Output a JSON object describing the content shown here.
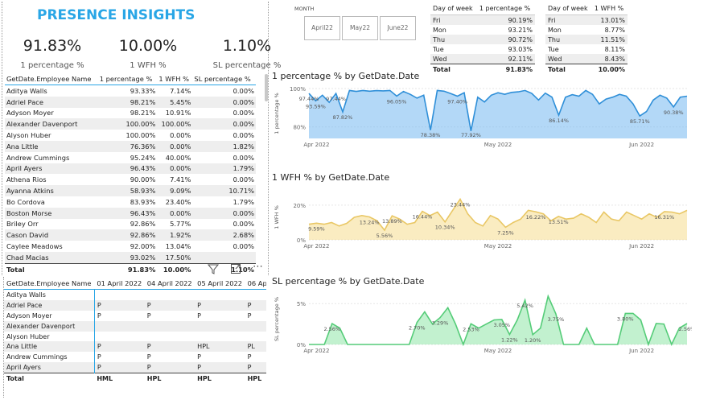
{
  "header": {
    "title": "PRESENCE INSIGHTS"
  },
  "kpis": [
    {
      "value": "91.83%",
      "label": "1 percentage %"
    },
    {
      "value": "10.00%",
      "label": "1 WFH %"
    },
    {
      "value": "1.10%",
      "label": "SL percentage %"
    }
  ],
  "employee_table": {
    "columns": [
      "GetDate.Employee Name",
      "1 percentage %",
      "1 WFH %",
      "SL percentage %"
    ],
    "rows": [
      [
        "Aditya Walls",
        "93.33%",
        "7.14%",
        "0.00%"
      ],
      [
        "Adriel Pace",
        "98.21%",
        "5.45%",
        "0.00%"
      ],
      [
        "Adyson Moyer",
        "98.21%",
        "10.91%",
        "0.00%"
      ],
      [
        "Alexander Davenport",
        "100.00%",
        "100.00%",
        "0.00%"
      ],
      [
        "Alyson Huber",
        "100.00%",
        "0.00%",
        "0.00%"
      ],
      [
        "Ana Little",
        "76.36%",
        "0.00%",
        "1.82%"
      ],
      [
        "Andrew Cummings",
        "95.24%",
        "40.00%",
        "0.00%"
      ],
      [
        "April Ayers",
        "96.43%",
        "0.00%",
        "1.79%"
      ],
      [
        "Athena Rios",
        "90.00%",
        "7.41%",
        "0.00%"
      ],
      [
        "Ayanna Atkins",
        "58.93%",
        "9.09%",
        "10.71%"
      ],
      [
        "Bo Cordova",
        "83.93%",
        "23.40%",
        "1.79%"
      ],
      [
        "Boston Morse",
        "96.43%",
        "0.00%",
        "0.00%"
      ],
      [
        "Briley Orr",
        "92.86%",
        "5.77%",
        "0.00%"
      ],
      [
        "Cason David",
        "92.86%",
        "1.92%",
        "2.68%"
      ],
      [
        "Caylee Meadows",
        "92.00%",
        "13.04%",
        "0.00%"
      ],
      [
        "Chad Macias",
        "93.02%",
        "17.50%",
        ""
      ]
    ],
    "total": [
      "Total",
      "91.83%",
      "10.00%",
      "1.10%"
    ]
  },
  "month_slicer": {
    "label": "MONTH",
    "options": [
      "April22",
      "May22",
      "June22"
    ]
  },
  "dow_table_1": {
    "columns": [
      "Day of week",
      "1 percentage %"
    ],
    "rows": [
      [
        "Fri",
        "90.19%"
      ],
      [
        "Mon",
        "93.21%"
      ],
      [
        "Thu",
        "90.72%"
      ],
      [
        "Tue",
        "93.03%"
      ],
      [
        "Wed",
        "92.11%"
      ]
    ],
    "total": [
      "Total",
      "91.83%"
    ]
  },
  "dow_table_2": {
    "columns": [
      "Day of week",
      "1 WFH %"
    ],
    "rows": [
      [
        "Fri",
        "13.01%"
      ],
      [
        "Mon",
        "8.77%"
      ],
      [
        "Thu",
        "11.51%"
      ],
      [
        "Tue",
        "8.11%"
      ],
      [
        "Wed",
        "8.43%"
      ]
    ],
    "total": [
      "Total",
      "10.00%"
    ]
  },
  "visual_header": {
    "filter_icon": "filter-icon",
    "focus_icon": "focus-mode-icon",
    "more_icon": "more-options-icon"
  },
  "attendance_table": {
    "columns": [
      "GetDate.Employee Name",
      "01 April 2022",
      "04 April 2022",
      "05 April 2022",
      "06 Ap"
    ],
    "rows": [
      [
        "Aditya Walls",
        "",
        "",
        "",
        ""
      ],
      [
        "Adriel Pace",
        "P",
        "P",
        "P",
        "P"
      ],
      [
        "Adyson Moyer",
        "P",
        "P",
        "P",
        "P"
      ],
      [
        "Alexander Davenport",
        "",
        "",
        "",
        ""
      ],
      [
        "Alyson Huber",
        "",
        "",
        "",
        ""
      ],
      [
        "Ana Little",
        "P",
        "P",
        "HPL",
        "PL"
      ],
      [
        "Andrew Cummings",
        "P",
        "P",
        "P",
        "P"
      ],
      [
        "April Ayers",
        "P",
        "P",
        "P",
        "P"
      ]
    ],
    "total": [
      "Total",
      "HML",
      "HPL",
      "HPL",
      "HPL"
    ]
  },
  "chart_data": [
    {
      "type": "area",
      "title": "1 percentage % by GetDate.Date",
      "xlabel": "",
      "ylabel": "1 percentage %",
      "x_ticks": [
        "Apr 2022",
        "May 2022",
        "Jun 2022"
      ],
      "y_ticks": [
        "80%",
        "100%"
      ],
      "ylim": [
        74,
        100
      ],
      "color": "#74b8f0",
      "values": [
        97.44,
        93.59,
        96.5,
        92.8,
        97.44,
        87.82,
        99.0,
        98.5,
        99.0,
        98.6,
        98.9,
        98.8,
        99.0,
        96.05,
        98.5,
        97.0,
        95.0,
        96.5,
        78.38,
        99.0,
        98.6,
        97.4,
        96.0,
        97.8,
        77.92,
        95.5,
        93.0,
        96.5,
        97.8,
        97.0,
        98.0,
        98.3,
        99.0,
        97.5,
        94.0,
        97.6,
        95.5,
        86.14,
        95.5,
        96.8,
        96.0,
        99.0,
        97.0,
        92.0,
        94.5,
        95.5,
        97.0,
        96.0,
        92.0,
        85.71,
        88.0,
        94.0,
        96.5,
        95.0,
        90.38,
        95.5,
        96.0
      ],
      "data_labels": [
        "97.44%",
        "93.59%",
        "97.44%",
        "87.82%",
        "96.05%",
        "78.38%",
        "97.40%",
        "77.92%",
        "86.14%",
        "85.71%",
        "90.38%"
      ]
    },
    {
      "type": "area",
      "title": "1 WFH % by GetDate.Date",
      "xlabel": "",
      "ylabel": "1 WFH %",
      "x_ticks": [
        "Apr 2022",
        "May 2022",
        "Jun 2022"
      ],
      "y_ticks": [
        "0%",
        "20%"
      ],
      "ylim": [
        0,
        26
      ],
      "color": "#f5dd8e",
      "values": [
        9.0,
        9.59,
        9.0,
        10.0,
        8.0,
        9.5,
        13.0,
        14.0,
        13.24,
        11.0,
        5.56,
        13.89,
        12.0,
        9.0,
        10.0,
        16.44,
        14.0,
        16.0,
        10.34,
        17.0,
        23.44,
        15.0,
        10.0,
        8.0,
        14.0,
        12.0,
        7.25,
        10.0,
        12.0,
        17.0,
        16.22,
        15.0,
        11.0,
        13.51,
        12.0,
        12.5,
        15.0,
        13.0,
        10.0,
        16.0,
        12.0,
        11.0,
        16.0,
        14.0,
        12.0,
        15.0,
        13.0,
        16.31,
        16.0,
        15.0,
        17.0
      ],
      "data_labels": [
        "9.59%",
        "13.24%",
        "5.56%",
        "13.89%",
        "16.44%",
        "23.44%",
        "10.34%",
        "7.25%",
        "16.22%",
        "13.51%",
        "16.31%"
      ]
    },
    {
      "type": "area",
      "title": "SL percentage % by GetDate.Date",
      "xlabel": "",
      "ylabel": "SL percentage %",
      "x_ticks": [
        "Apr 2022",
        "May 2022",
        "Jun 2022"
      ],
      "y_ticks": [
        "0%",
        "5%"
      ],
      "ylim": [
        0,
        6.2
      ],
      "color": "#90e6a8",
      "values": [
        0,
        0,
        0,
        2.56,
        2.0,
        0,
        0,
        0,
        0,
        0,
        0,
        0,
        0,
        0,
        2.7,
        4.0,
        2.5,
        3.29,
        4.5,
        2.5,
        0,
        2.53,
        2.0,
        2.5,
        3.0,
        3.05,
        1.22,
        3.0,
        5.42,
        1.2,
        2.0,
        5.9,
        3.75,
        0,
        0,
        0,
        2.0,
        0,
        0,
        0,
        0,
        3.8,
        3.8,
        3.0,
        0,
        2.56,
        2.5,
        0,
        2.0,
        2.56
      ],
      "data_labels": [
        "2.56%",
        "2.70%",
        "3.29%",
        "2.53%",
        "3.05%",
        "1.22%",
        "5.42%",
        "3.75%",
        "1.20%",
        "3.80%",
        "2.56%"
      ]
    }
  ]
}
